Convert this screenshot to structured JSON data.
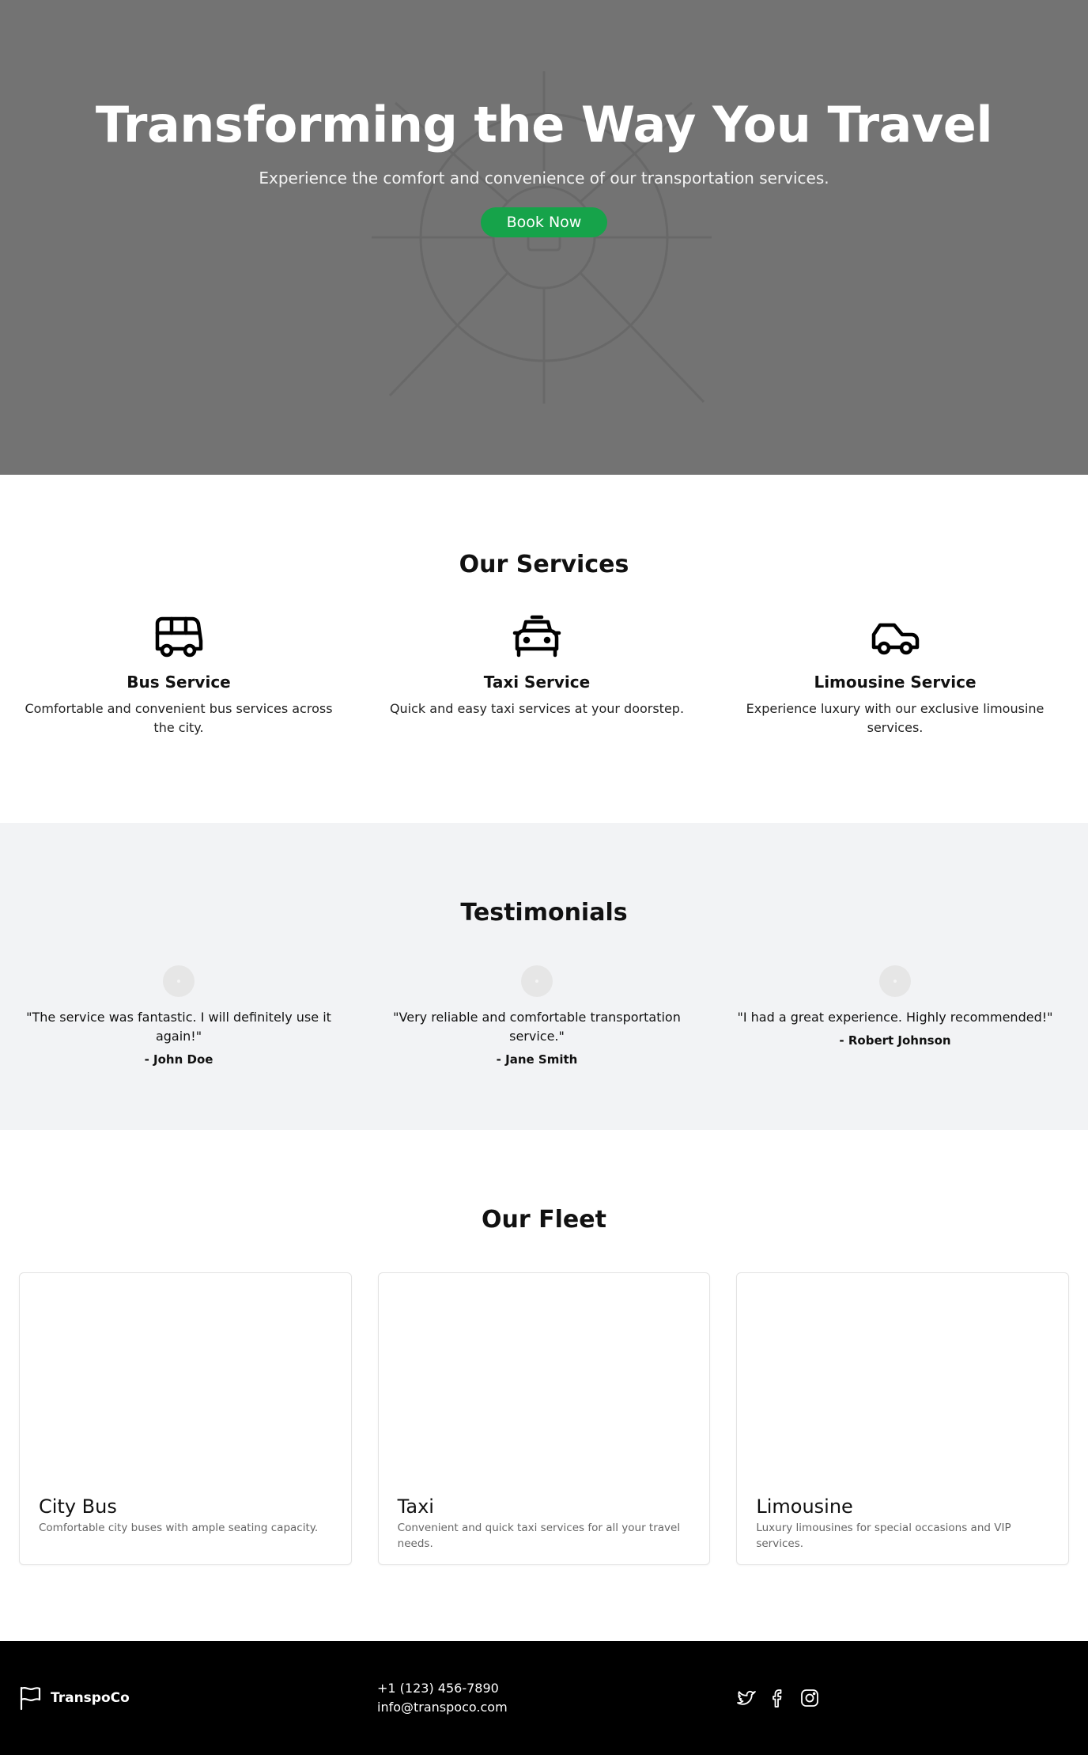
{
  "hero": {
    "title": "Transforming the Way You Travel",
    "subtitle": "Experience the comfort and convenience of our transportation services.",
    "button_label": "Book Now",
    "button_color": "#16a34a",
    "background_color": "#737373"
  },
  "services": {
    "title": "Our Services",
    "items": [
      {
        "icon": "bus-icon",
        "title": "Bus Service",
        "description": "Comfortable and convenient bus services across the city."
      },
      {
        "icon": "taxi-icon",
        "title": "Taxi Service",
        "description": "Quick and easy taxi services at your doorstep."
      },
      {
        "icon": "car-icon",
        "title": "Limousine Service",
        "description": "Experience luxury with our exclusive limousine services."
      }
    ]
  },
  "testimonials": {
    "title": "Testimonials",
    "items": [
      {
        "quote": "\"The service was fantastic. I will definitely use it again!\"",
        "author": "- John Doe"
      },
      {
        "quote": "\"Very reliable and comfortable transportation service.\"",
        "author": "- Jane Smith"
      },
      {
        "quote": "\"I had a great experience. Highly recommended!\"",
        "author": "- Robert Johnson"
      }
    ]
  },
  "fleet": {
    "title": "Our Fleet",
    "items": [
      {
        "title": "City Bus",
        "description": "Comfortable city buses with ample seating capacity."
      },
      {
        "title": "Taxi",
        "description": "Convenient and quick taxi services for all your travel needs."
      },
      {
        "title": "Limousine",
        "description": "Luxury limousines for special occasions and VIP services."
      }
    ]
  },
  "footer": {
    "brand": "TranspoCo",
    "brand_icon": "flag-icon",
    "phone": "+1 (123) 456-7890",
    "email": "info@transpoco.com",
    "socials": [
      "twitter-icon",
      "facebook-icon",
      "instagram-icon"
    ]
  }
}
